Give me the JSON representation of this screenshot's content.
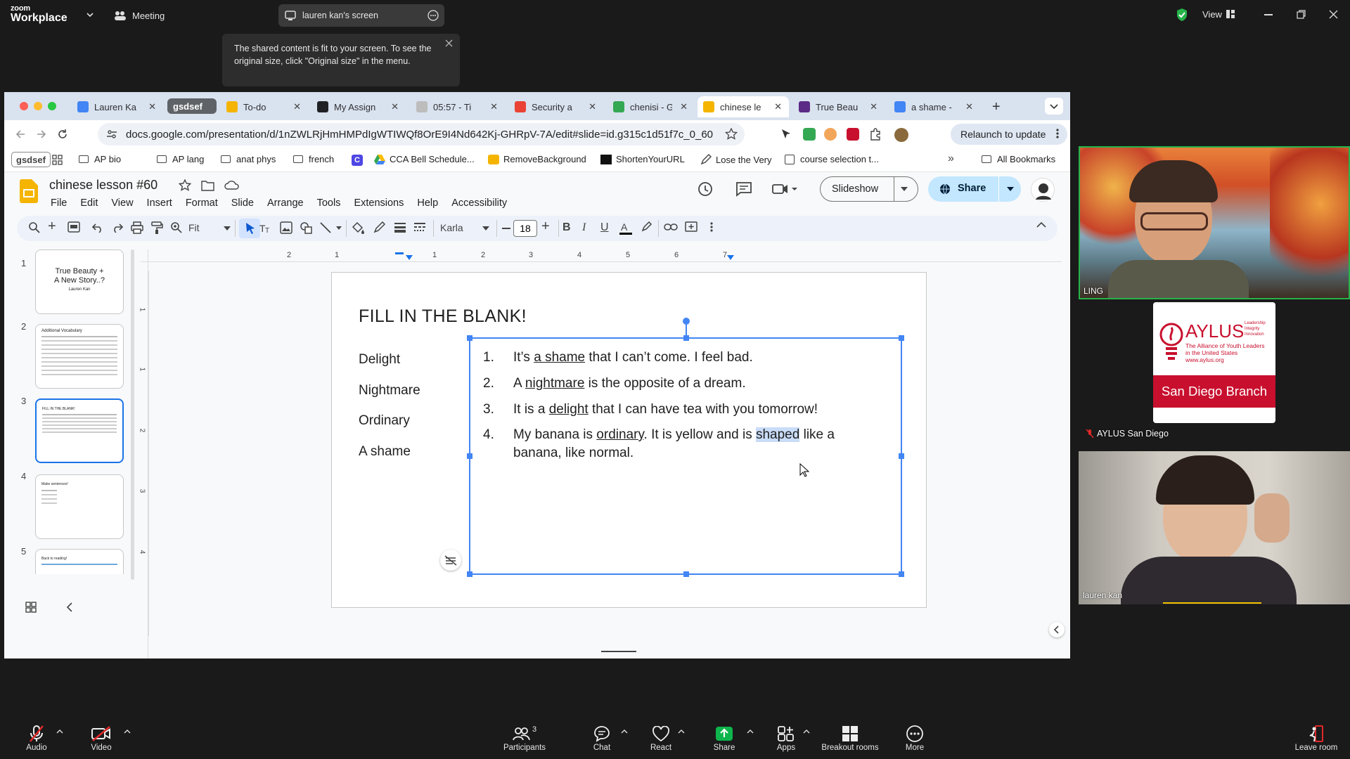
{
  "zoom": {
    "logo_small": "zoom",
    "logo_big": "Workplace",
    "meeting_label": "Meeting",
    "screen_pill": "lauren kan's screen",
    "tooltip": "The shared content is fit to your screen. To see the original size, click \"Original size\" in the menu.",
    "view_label": "View"
  },
  "browser": {
    "tabs": [
      {
        "label": "Lauren Ka",
        "color": "#4285f4"
      },
      {
        "label": "gsdsef",
        "color": "#5f6368"
      },
      {
        "label": "To-do",
        "color": "#f4b400"
      },
      {
        "label": "My Assign",
        "color": "#202124"
      },
      {
        "label": "05:57 - Ti",
        "color": "#bdbdbd"
      },
      {
        "label": "Security a",
        "color": "#ea4335"
      },
      {
        "label": "chenisi - G",
        "color": "#34a853"
      },
      {
        "label": "chinese le",
        "color": "#f4b400"
      },
      {
        "label": "True Beau",
        "color": "#5b2a86"
      },
      {
        "label": "a shame -",
        "color": "#4285f4"
      }
    ],
    "url": "docs.google.com/presentation/d/1nZWLRjHmHMPdIgWTIWQf8OrE9I4Nd642Kj-GHRpV-7A/edit#slide=id.g315c1d51f7c_0_60",
    "relaunch": "Relaunch to update",
    "bookmarks": [
      "gsdsef",
      "AP bio",
      "AP lang",
      "anat phys",
      "french",
      "CCA Bell Schedule...",
      "RemoveBackground",
      "ShortenYourURL",
      "Lose the Very",
      "course selection t...",
      "All Bookmarks"
    ]
  },
  "docs": {
    "title": "chinese lesson #60",
    "menu": [
      "File",
      "Edit",
      "View",
      "Insert",
      "Format",
      "Slide",
      "Arrange",
      "Tools",
      "Extensions",
      "Help",
      "Accessibility"
    ],
    "slideshow": "Slideshow",
    "share": "Share",
    "zoom": "Fit",
    "font": "Karla",
    "font_size": "18",
    "ruler": [
      "2",
      "1",
      "1",
      "2",
      "3",
      "4",
      "5",
      "6",
      "7"
    ],
    "vruler": [
      "1",
      "1",
      "2",
      "3",
      "4"
    ],
    "thumbs": [
      {
        "num": "1",
        "l1": "True Beauty +",
        "l2": "A New Story..?",
        "l3": "Lauren Kan"
      },
      {
        "num": "2",
        "l1": "Additional Vocabulary"
      },
      {
        "num": "3",
        "l1": "FILL IN THE BLANK!"
      },
      {
        "num": "4",
        "l1": "Make sentences!"
      },
      {
        "num": "5",
        "l1": "Back to reading!"
      }
    ],
    "slide": {
      "heading": "FILL IN THE BLANK!",
      "words": [
        "Delight",
        "Nightmare",
        "Ordinary",
        "A shame"
      ],
      "items": [
        {
          "num": "1.",
          "pre": "It’s ",
          "u": "a shame",
          "post": " that I can’t come. I feel bad."
        },
        {
          "num": "2.",
          "pre": "A ",
          "u": "nightmare",
          "post": " is the opposite of a dream."
        },
        {
          "num": "3.",
          "pre": "It is a ",
          "u": "delight",
          "post": " that I can have tea with you tomorrow!"
        },
        {
          "num": "4.",
          "pre": "My banana is ",
          "u": "ordinary",
          "mid": ". It is yellow and is ",
          "hl": "shaped",
          "post": " like a",
          "line2": "banana, like normal."
        }
      ]
    }
  },
  "participants": {
    "p1": "LING",
    "p2": "AYLUS San Diego",
    "p3": "lauren kan",
    "aylus_title": "AYLUS",
    "aylus_sub1": "The Alliance of Youth Leaders",
    "aylus_sub2": "in the United States",
    "aylus_url": "www.aylus.org",
    "aylus_tag1": "Leadership",
    "aylus_tag2": "Integrity",
    "aylus_tag3": "Innovation",
    "aylus_branch": "San Diego Branch"
  },
  "controls": {
    "audio": "Audio",
    "video": "Video",
    "participants": "Participants",
    "participants_count": "3",
    "chat": "Chat",
    "react": "React",
    "share": "Share",
    "apps": "Apps",
    "breakout": "Breakout rooms",
    "more": "More",
    "leave": "Leave room"
  },
  "colors": {
    "share_green": "#0eb44c",
    "select_blue": "#1a73e8",
    "aylus_red": "#c8102e"
  }
}
